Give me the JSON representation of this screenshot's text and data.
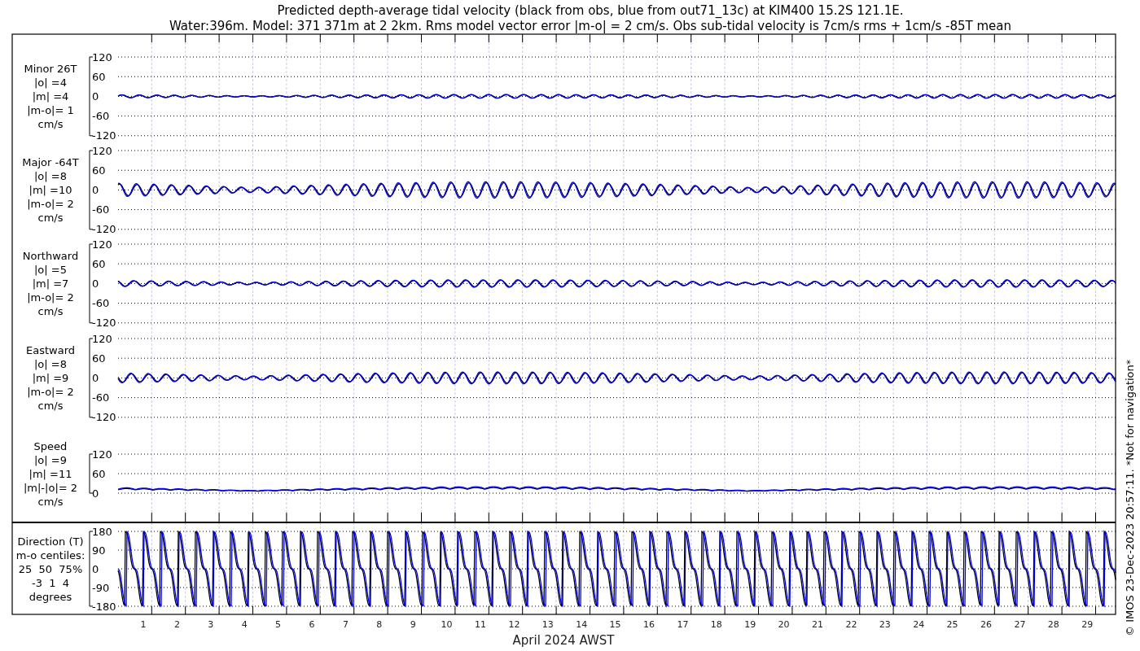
{
  "title_lines": [
    "Predicted depth-average tidal velocity (black from obs, blue from out71_13c) at KIM400 15.2S 121.1E.",
    "Water:396m. Model: 371 371m at 2 2km. Rms model vector error |m-o| = 2 cm/s. Obs sub-tidal velocity is 7cm/s rms + 1cm/s -85T mean"
  ],
  "panels": [
    {
      "kind": "velocity",
      "label_lines": [
        "Minor 26T",
        "|o| =4",
        "|m| =4",
        "|m-o|= 1",
        "cm/s"
      ],
      "yticks": [
        "120",
        "60",
        "0",
        "-60",
        "-120"
      ]
    },
    {
      "kind": "velocity",
      "label_lines": [
        "Major -64T",
        "|o| =8",
        "|m| =10",
        "|m-o|= 2",
        "cm/s"
      ],
      "yticks": [
        "120",
        "60",
        "0",
        "-60",
        "-120"
      ]
    },
    {
      "kind": "velocity",
      "label_lines": [
        "Northward",
        "|o| =5",
        "|m| =7",
        "|m-o|= 2",
        "cm/s"
      ],
      "yticks": [
        "120",
        "60",
        "0",
        "-60",
        "-120"
      ]
    },
    {
      "kind": "velocity",
      "label_lines": [
        "Eastward",
        "|o| =8",
        "|m| =9",
        "|m-o|= 2",
        "cm/s"
      ],
      "yticks": [
        "120",
        "60",
        "0",
        "-60",
        "-120"
      ]
    },
    {
      "kind": "speed",
      "label_lines": [
        "Speed",
        "|o| =9",
        "|m| =11",
        "|m|-|o|= 2",
        "cm/s"
      ],
      "yticks": [
        "120",
        "60",
        "0"
      ]
    },
    {
      "kind": "direction",
      "label_lines": [
        "Direction (T)",
        "m-o centiles:",
        "25  50  75%",
        "-3  1  4",
        "degrees"
      ],
      "yticks": [
        "180",
        "90",
        "0",
        "-90",
        "-180"
      ]
    }
  ],
  "x_axis": {
    "day_labels": [
      "1",
      "2",
      "3",
      "4",
      "5",
      "6",
      "7",
      "8",
      "9",
      "10",
      "11",
      "12",
      "13",
      "14",
      "15",
      "16",
      "17",
      "18",
      "19",
      "20",
      "21",
      "22",
      "23",
      "24",
      "25",
      "26",
      "27",
      "28",
      "29"
    ],
    "label": "April 2024 AWST"
  },
  "credit": "© IMOS 23-Dec-2023 20:57:11. *Not for navigation*"
}
